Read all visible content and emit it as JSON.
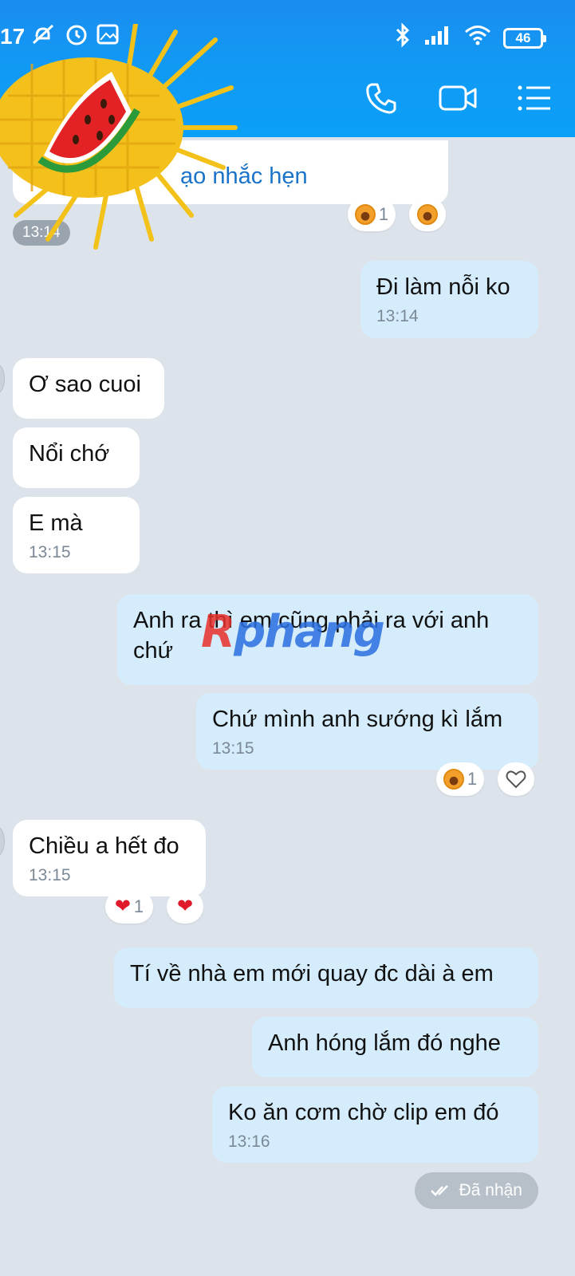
{
  "status_bar": {
    "time": "17",
    "battery": "46"
  },
  "header": {
    "actions": [
      {
        "name": "phone-icon"
      },
      {
        "name": "video-call-icon"
      },
      {
        "name": "menu-list-icon"
      }
    ]
  },
  "messages": {
    "reminder_text": "ạo nhắc hẹn",
    "reminder_time": "13:14",
    "m1": {
      "text": "Đi làm nỗi ko",
      "time": "13:14"
    },
    "m2": {
      "text": "Ơ sao cuoi"
    },
    "m3": {
      "text": "Nổi chớ"
    },
    "m4": {
      "text": "E mà",
      "time": "13:15"
    },
    "m5": {
      "text": "Anh ra thì em cũng phải ra với anh chứ"
    },
    "m6": {
      "text": "Chứ mình anh sướng kì lắm",
      "time": "13:15"
    },
    "m7": {
      "text": "Chiều a hết đo",
      "time": "13:15"
    },
    "m8": {
      "text": "Tí về nhà em mới quay đc dài à em"
    },
    "m9": {
      "text": "Anh hóng lắm đó nghe"
    },
    "m10": {
      "text": "Ko ăn cơm chờ clip em đó",
      "time": "13:16"
    }
  },
  "reactions": {
    "r1_count": "1",
    "r2_count": "1",
    "r3_count": "1"
  },
  "received_label": "Đã nhận",
  "watermark": {
    "part1": "R",
    "part2": "phang"
  }
}
